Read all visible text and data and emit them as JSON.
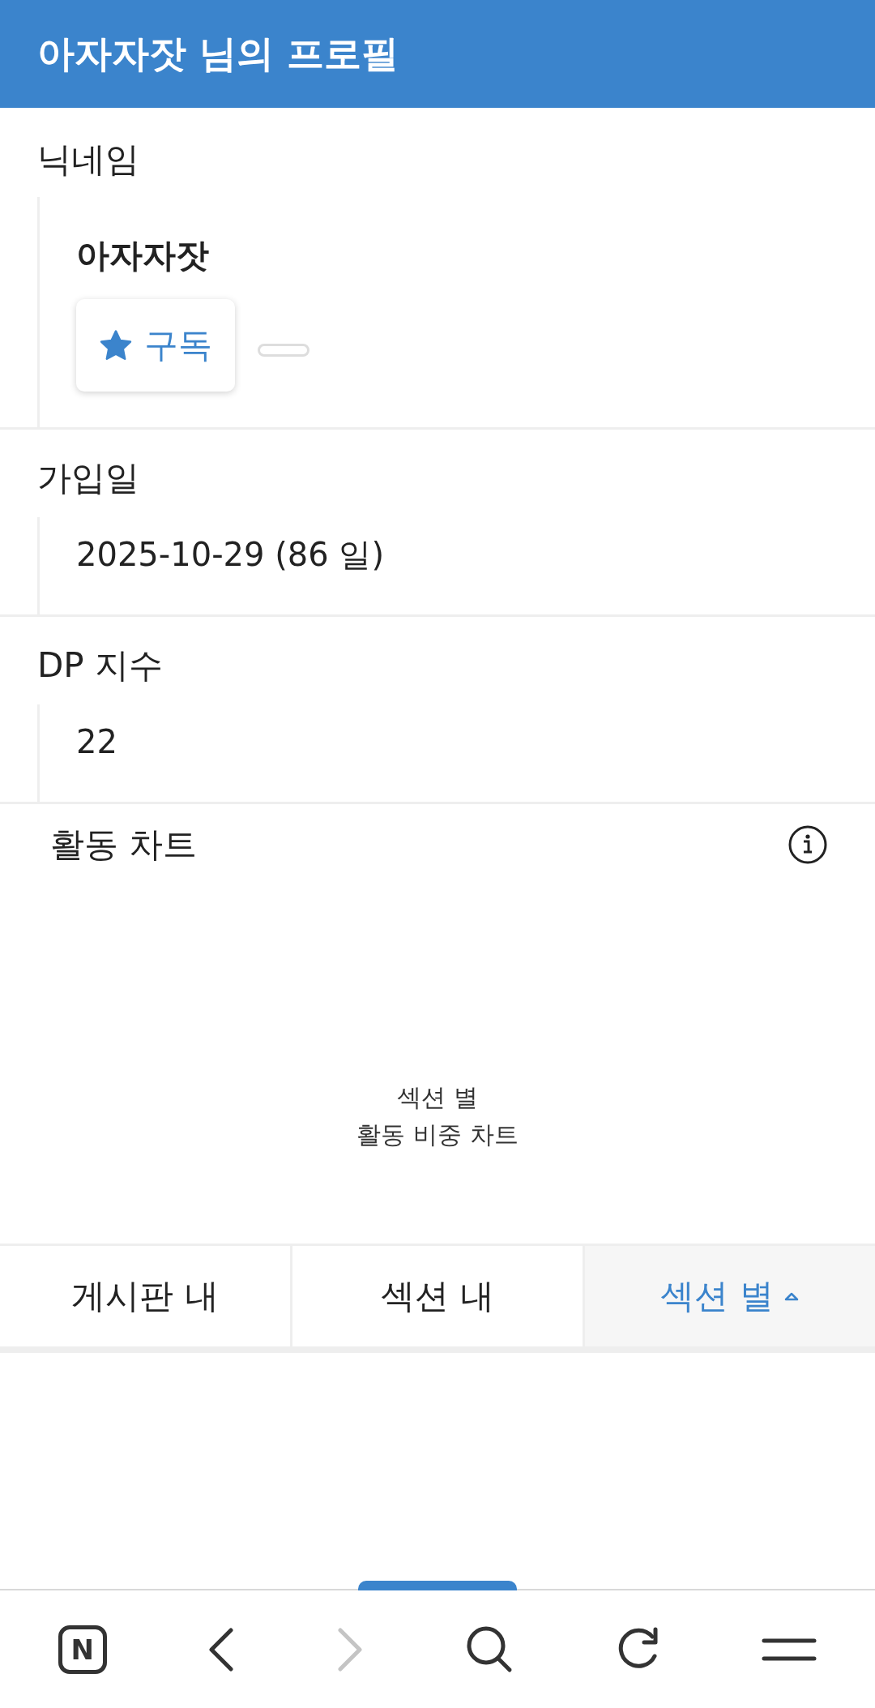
{
  "header": {
    "title": "아자자잣 님의 프로필"
  },
  "fields": [
    {
      "kind": "profile",
      "label": "닉네임",
      "name": "아자자잣",
      "subscribe_label": "구독"
    },
    {
      "kind": "text",
      "label": "가입일",
      "value": "2025-10-29 (86 일)"
    },
    {
      "kind": "text",
      "label": "DP 지수",
      "value": "22"
    }
  ],
  "activity_chart": {
    "title": "활동 차트",
    "placeholder": "섹션 별\n활동 비중 차트"
  },
  "chart_tabs": [
    {
      "label": "게시판 내",
      "selected": false
    },
    {
      "label": "섹션 내",
      "selected": false
    },
    {
      "label": "섹션 별",
      "selected": true
    }
  ],
  "browser_bar": {
    "logo": "N",
    "forward_disabled": true
  }
}
